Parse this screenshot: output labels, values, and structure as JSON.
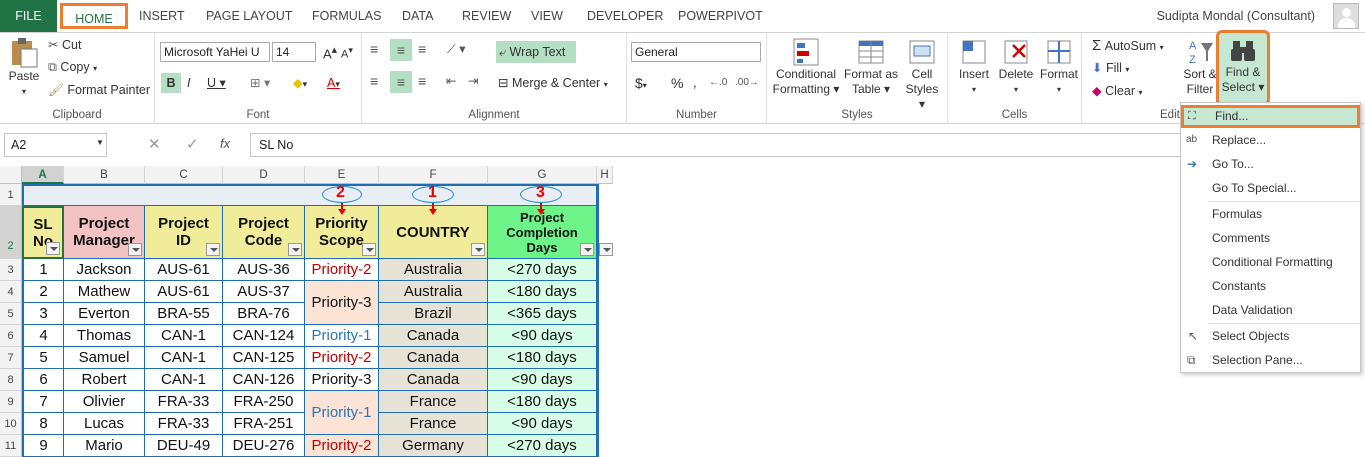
{
  "tabs": {
    "file": "FILE",
    "home": "HOME",
    "insert": "INSERT",
    "page_layout": "PAGE LAYOUT",
    "formulas": "FORMULAS",
    "data": "DATA",
    "review": "REVIEW",
    "view": "VIEW",
    "developer": "DEVELOPER",
    "powerpivot": "POWERPIVOT"
  },
  "user": "Sudipta Mondal (Consultant)",
  "clipboard": {
    "paste": "Paste",
    "cut": "Cut",
    "copy": "Copy",
    "format_painter": "Format Painter",
    "label": "Clipboard"
  },
  "font": {
    "name": "Microsoft YaHei U",
    "size": "14",
    "label": "Font"
  },
  "alignment": {
    "wrap": "Wrap Text",
    "merge": "Merge & Center",
    "label": "Alignment"
  },
  "number": {
    "format": "General",
    "label": "Number",
    "dollar": "$",
    "percent": "%"
  },
  "styles": {
    "cond": "Conditional",
    "cond2": "Formatting",
    "fmt_table": "Format as",
    "fmt_table2": "Table",
    "cell_styles": "Cell",
    "cell_styles2": "Styles",
    "label": "Styles"
  },
  "cells": {
    "insert": "Insert",
    "delete": "Delete",
    "format": "Format",
    "label": "Cells"
  },
  "editing": {
    "autosum": "AutoSum",
    "fill": "Fill",
    "clear": "Clear",
    "sort": "Sort &",
    "sort2": "Filter",
    "find": "Find &",
    "find2": "Select",
    "label": "Edit"
  },
  "formula_bar": {
    "name_box": "A2",
    "content": "SL No",
    "fx": "fx"
  },
  "columns": [
    "A",
    "B",
    "C",
    "D",
    "E",
    "F",
    "G",
    "H"
  ],
  "rows": [
    "1",
    "2",
    "3",
    "4",
    "5",
    "6",
    "7",
    "8",
    "9",
    "10",
    "11"
  ],
  "headers": {
    "sl": "SL No",
    "manager": "Project Manager",
    "pid": "Project ID",
    "pcode": "Project Code",
    "priority": "Priority Scope",
    "country": "COUNTRY",
    "days": "Project Completion Days"
  },
  "annotations": [
    "2",
    "1",
    "3"
  ],
  "table": [
    {
      "sl": "1",
      "mgr": "Jackson",
      "pid": "AUS-61",
      "code": "AUS-36",
      "country": "Australia",
      "days": "<270 days"
    },
    {
      "sl": "2",
      "mgr": "Mathew",
      "pid": "AUS-61",
      "code": "AUS-37",
      "country": "Australia",
      "days": "<180 days"
    },
    {
      "sl": "3",
      "mgr": "Everton",
      "pid": "BRA-55",
      "code": "BRA-76",
      "country": "Brazil",
      "days": "<365 days"
    },
    {
      "sl": "4",
      "mgr": "Thomas",
      "pid": "CAN-1",
      "code": "CAN-124",
      "country": "Canada",
      "days": "<90 days"
    },
    {
      "sl": "5",
      "mgr": "Samuel",
      "pid": "CAN-1",
      "code": "CAN-125",
      "country": "Canada",
      "days": "<180 days"
    },
    {
      "sl": "6",
      "mgr": "Robert",
      "pid": "CAN-1",
      "code": "CAN-126",
      "country": "Canada",
      "days": "<90 days"
    },
    {
      "sl": "7",
      "mgr": "Olivier",
      "pid": "FRA-33",
      "code": "FRA-250",
      "country": "France",
      "days": "<180 days"
    },
    {
      "sl": "8",
      "mgr": "Lucas",
      "pid": "FRA-33",
      "code": "FRA-251",
      "country": "France",
      "days": "<90 days"
    },
    {
      "sl": "9",
      "mgr": "Mario",
      "pid": "DEU-49",
      "code": "DEU-276",
      "country": "Germany",
      "days": "<270 days"
    }
  ],
  "priority": {
    "p2a": "Priority-2",
    "p3a": "Priority-3",
    "p1a": "Priority-1",
    "p2b": "Priority-2",
    "p3b": "Priority-3",
    "p1b": "Priority-1",
    "p2c": "Priority-2"
  },
  "menu": [
    "Find...",
    "Replace...",
    "Go To...",
    "Go To Special...",
    "Formulas",
    "Comments",
    "Conditional Formatting",
    "Constants",
    "Data Validation",
    "Select Objects",
    "Selection Pane..."
  ],
  "colors": {
    "excel_green": "#217346",
    "highlight_orange": "#ed7d31",
    "table_border": "#1f6db3",
    "annotation_red": "#e00000",
    "ellipse_blue": "#1e8fd8"
  }
}
